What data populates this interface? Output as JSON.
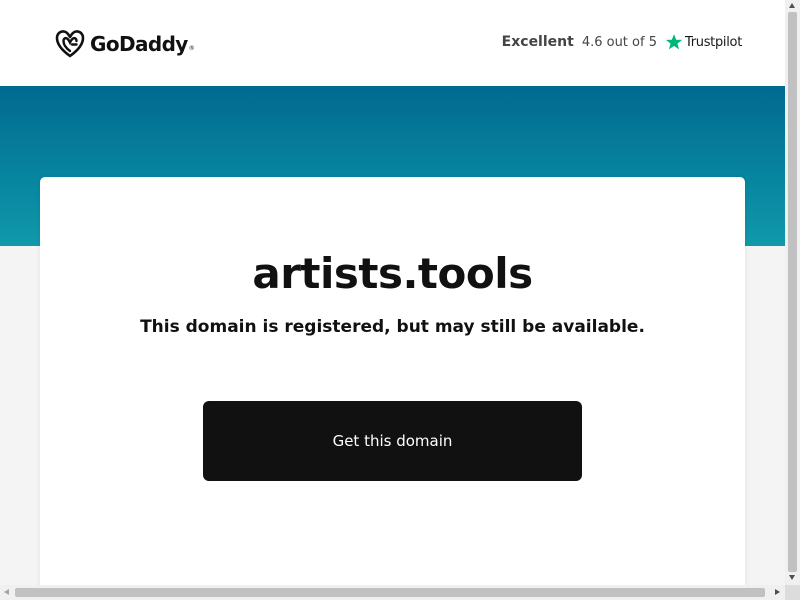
{
  "header": {
    "logo": {
      "text": "GoDaddy",
      "trademark": "®",
      "icon": "godaddy-logo-icon"
    },
    "trustpilot": {
      "rating_label": "Excellent",
      "score_text": "4.6 out of 5",
      "brand": "Trustpilot",
      "icon": "star-icon",
      "star_color": "#00b67a"
    }
  },
  "hero": {
    "band_colors": [
      "#02698f",
      "#1199ab"
    ]
  },
  "card": {
    "domain": "artists.tools",
    "subtitle": "This domain is registered, but may still be available.",
    "cta_label": "Get this domain",
    "cta_color": "#111111"
  },
  "scrollbars": {
    "vertical": true,
    "horizontal": true
  }
}
